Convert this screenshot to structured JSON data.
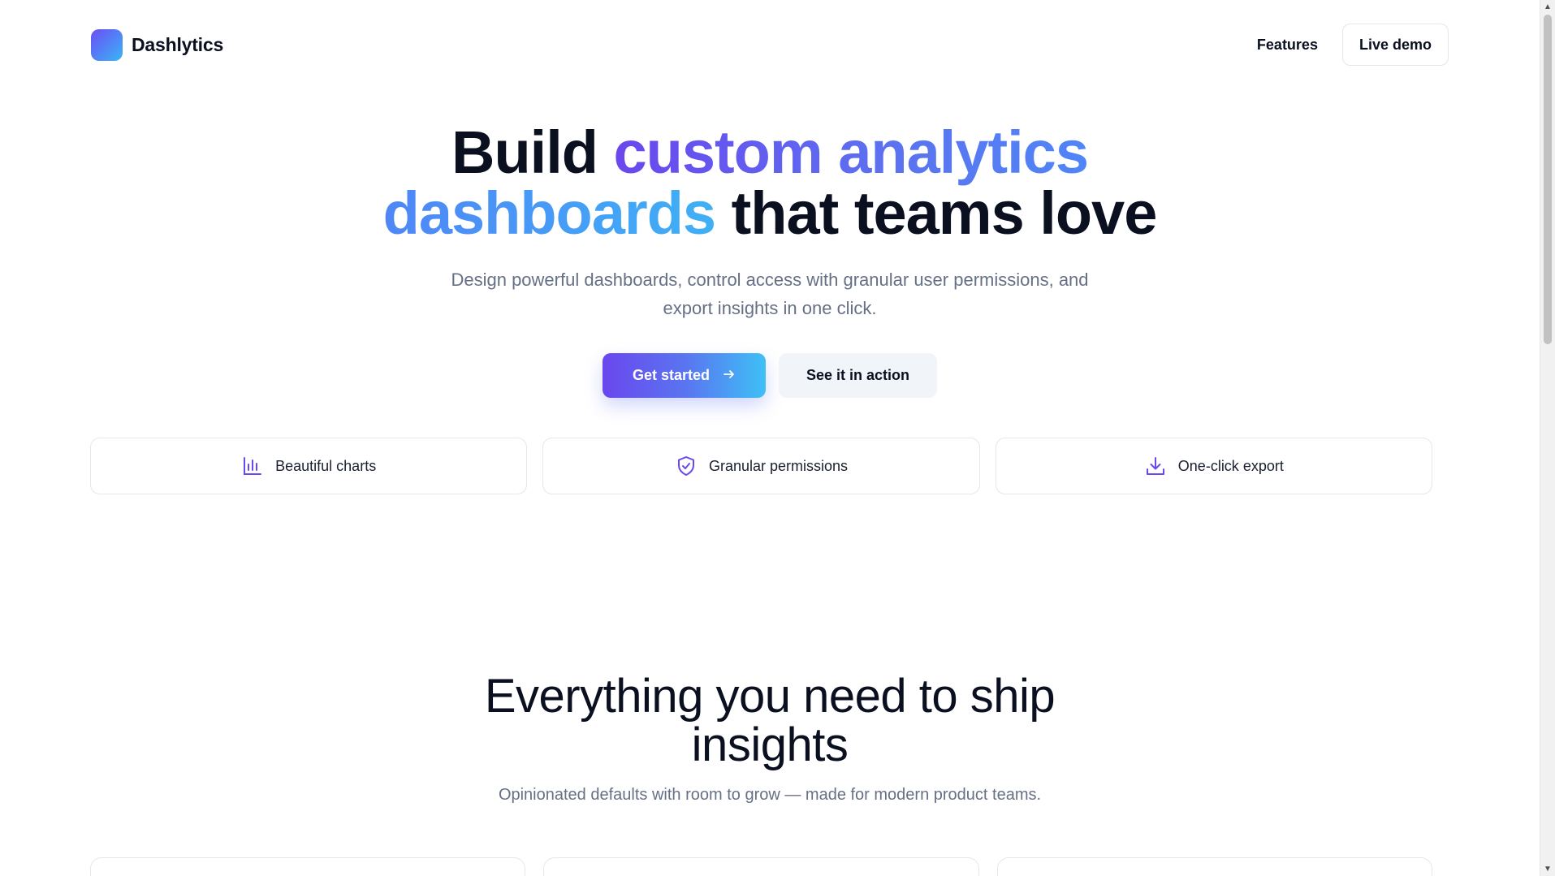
{
  "nav": {
    "brand": "Dashlytics",
    "links": [
      {
        "label": "Features"
      }
    ],
    "cta": "Live demo"
  },
  "hero": {
    "title_part1": "Build ",
    "title_grad1": "custom analytics",
    "title_grad2": "dashboards",
    "title_part2": " that teams love",
    "subtitle_line1": "Design powerful dashboards, control access with granular user permissions, and",
    "subtitle_line2": "export insights in one click.",
    "primary_cta": "Get started",
    "secondary_cta": "See it in action"
  },
  "features": [
    {
      "label": "Beautiful charts",
      "icon": "bar-chart-icon"
    },
    {
      "label": "Granular permissions",
      "icon": "shield-check-icon"
    },
    {
      "label": "One-click export",
      "icon": "download-icon"
    }
  ],
  "section2": {
    "title_line1": "Everything you need to ship",
    "title_line2": "insights",
    "subtitle": "Opinionated defaults with room to grow — made for modern product teams."
  },
  "colors": {
    "accent_purple": "#6a47ee",
    "accent_blue": "#4f86f7",
    "accent_cyan": "#3ec0f6",
    "text_dark": "#0b1020",
    "text_muted": "#667085"
  }
}
